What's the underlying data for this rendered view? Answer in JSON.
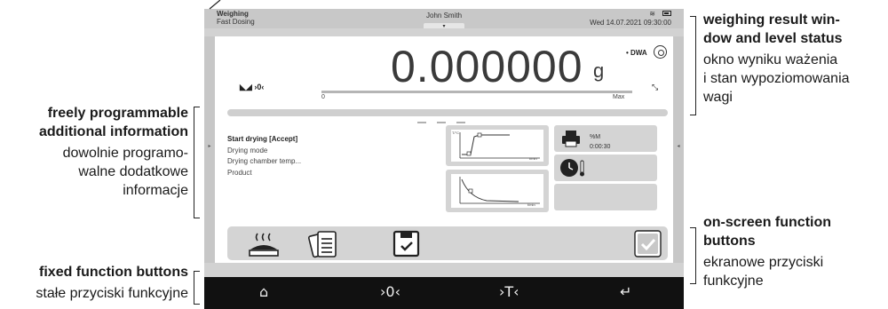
{
  "callouts": {
    "result_en_1": "weighing result win-",
    "result_en_2": "dow and level status",
    "result_pl_1": "okno wyniku ważenia",
    "result_pl_2": "i stan wypoziomowania",
    "result_pl_3": "wagi",
    "info_en_1": "freely programmable",
    "info_en_2": "additional information",
    "info_pl_1": "dowolnie programo-",
    "info_pl_2": "walne dodatkowe",
    "info_pl_3": "informacje",
    "onscreen_en_1": "on-screen function",
    "onscreen_en_2": "buttons",
    "onscreen_pl_1": "ekranowe przyciski",
    "onscreen_pl_2": "funkcyjne",
    "fixed_en": "fixed function buttons",
    "fixed_pl": "stałe przyciski funkcyjne"
  },
  "topbar": {
    "app": "Weighing",
    "mode": "Fast Dosing",
    "user": "John Smith",
    "datetime": "Wed 14.07.2021  09:30:00",
    "wifi_icon": "wifi-icon",
    "battery_icon": "battery-icon"
  },
  "weight": {
    "value": "0.000000",
    "unit": "g",
    "dwa": "• DWA",
    "status": "◣◢ ›0‹",
    "range_zero": "0",
    "range_max": "Max",
    "stability_icon": "⤡"
  },
  "info": {
    "line1": "Start drying [Accept]",
    "line2": "Drying mode",
    "line3": "Drying chamber temp...",
    "line4": "Product"
  },
  "cards": {
    "print_l1": "%M",
    "print_l2": "0:00:30",
    "graph1_y": "T/°C",
    "graph1_x": "t/min",
    "graph2_x": "t/min"
  },
  "function_buttons": [
    "drying-heat-icon",
    "protocol-list-icon",
    "save-check-icon",
    "accept-check-icon"
  ],
  "fixed_buttons": {
    "home": "⌂",
    "zero": "›0‹",
    "tare": "›T‹",
    "enter": "↵"
  }
}
